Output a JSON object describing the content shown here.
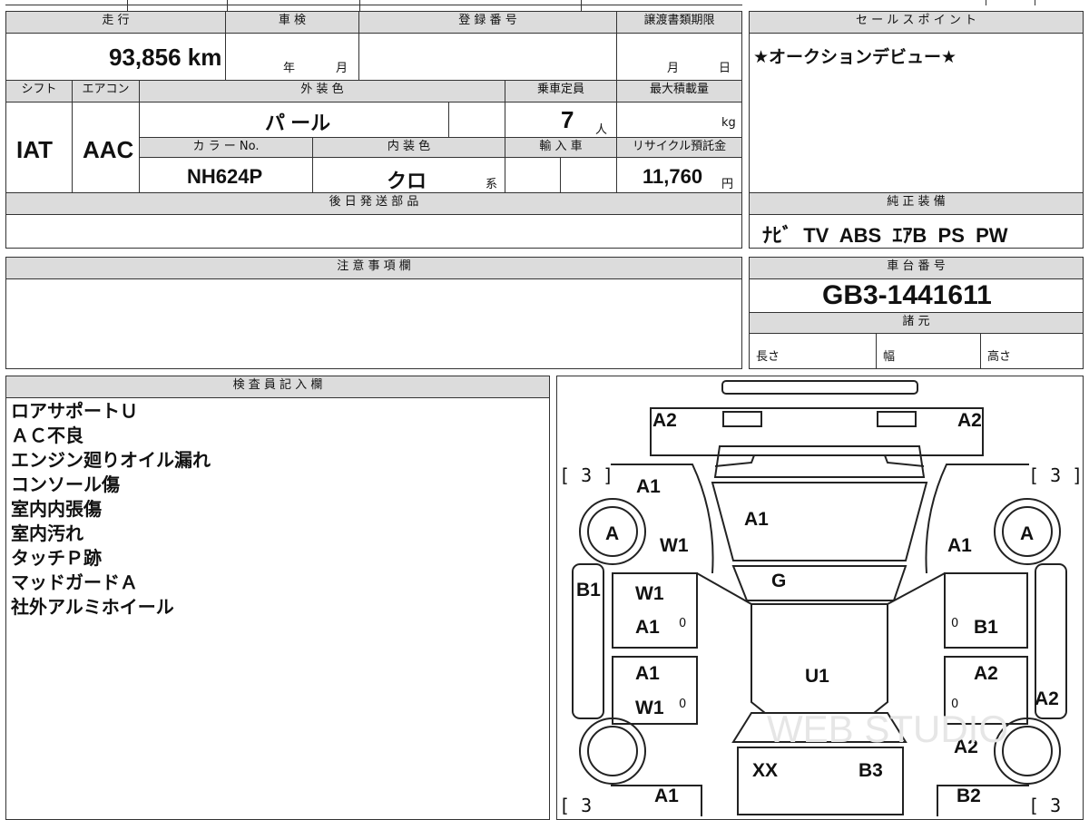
{
  "left_table": {
    "mileage_label": "走 行",
    "mileage_value": "93,856 km",
    "shaken_label": "車 検",
    "shaken_year": "年",
    "shaken_month": "月",
    "registration_label": "登 録 番 号",
    "transfer_label": "譲渡書類期限",
    "transfer_month": "月",
    "transfer_day": "日",
    "shift_label": "シフト",
    "shift_value": "IAT",
    "ac_label": "エアコン",
    "ac_value": "AAC",
    "exterior_color_label": "外 装 色",
    "exterior_color_value": "パ ール",
    "capacity_label": "乗車定員",
    "capacity_value": "7",
    "capacity_unit": "人",
    "max_load_label": "最大積載量",
    "max_load_unit": "kg",
    "color_no_label": "カ ラ ー No.",
    "color_no_value": "NH624P",
    "interior_color_label": "内 装 色",
    "interior_color_value": "クロ",
    "interior_color_suffix": "系",
    "import_label": "輸 入 車",
    "recycle_label": "リサイクル預託金",
    "recycle_value": "11,760",
    "recycle_unit": "円",
    "later_parts_label": "後 日 発 送 部 品"
  },
  "sales_point": {
    "label": "セ ー ル ス ポ イ ン ト",
    "text": "★オークションデビュー★"
  },
  "equipment": {
    "label": "純 正 装 備",
    "text": "ﾅﾋﾞ  TV  ABS  ｴｱB  PS  PW"
  },
  "caution": {
    "label": "注 意 事 項 欄"
  },
  "chassis": {
    "label": "車 台 番 号",
    "value": "GB3-1441611",
    "specs_label": "諸 元",
    "length_label": "長さ",
    "width_label": "幅",
    "height_label": "高さ"
  },
  "inspector": {
    "label": "検 査 員 記 入 欄",
    "notes": [
      "ロアサポートＵ",
      "ＡＣ不良",
      "エンジン廻りオイル漏れ",
      "コンソール傷",
      "室内内張傷",
      "室内汚れ",
      "タッチＰ跡",
      "マッドガードＡ",
      "社外アルミホイール"
    ]
  },
  "diagram": {
    "front_bumper_left": "A2",
    "front_bumper_right": "A2",
    "tire_fl_bracket": "[ 3 ]",
    "tire_fr_bracket": "[ 3 ]",
    "tire_rl_bracket": "[ 3",
    "tire_rr_bracket": "[ 3",
    "fender_left": "A1",
    "hood": "A1",
    "wheel_fl": "A",
    "wheel_fr": "A",
    "fender_left_w": "W1",
    "fender_right": "A1",
    "windshield": "G",
    "sill_left": "B1",
    "front_door_left_w": "W1",
    "front_door_left_a": "A1",
    "front_door_right": "B1",
    "roof": "U1",
    "rear_door_left_a": "A1",
    "rear_door_left_w": "W1",
    "rear_door_right": "A2",
    "sill_right": "A2",
    "quarter_right": "A2",
    "rear_left": "A1",
    "rear_glass": "XX",
    "rear_right": "B3",
    "rear_bumper_right": "B2",
    "zero_mark": "0",
    "watermark": "WEB STUDIO"
  }
}
